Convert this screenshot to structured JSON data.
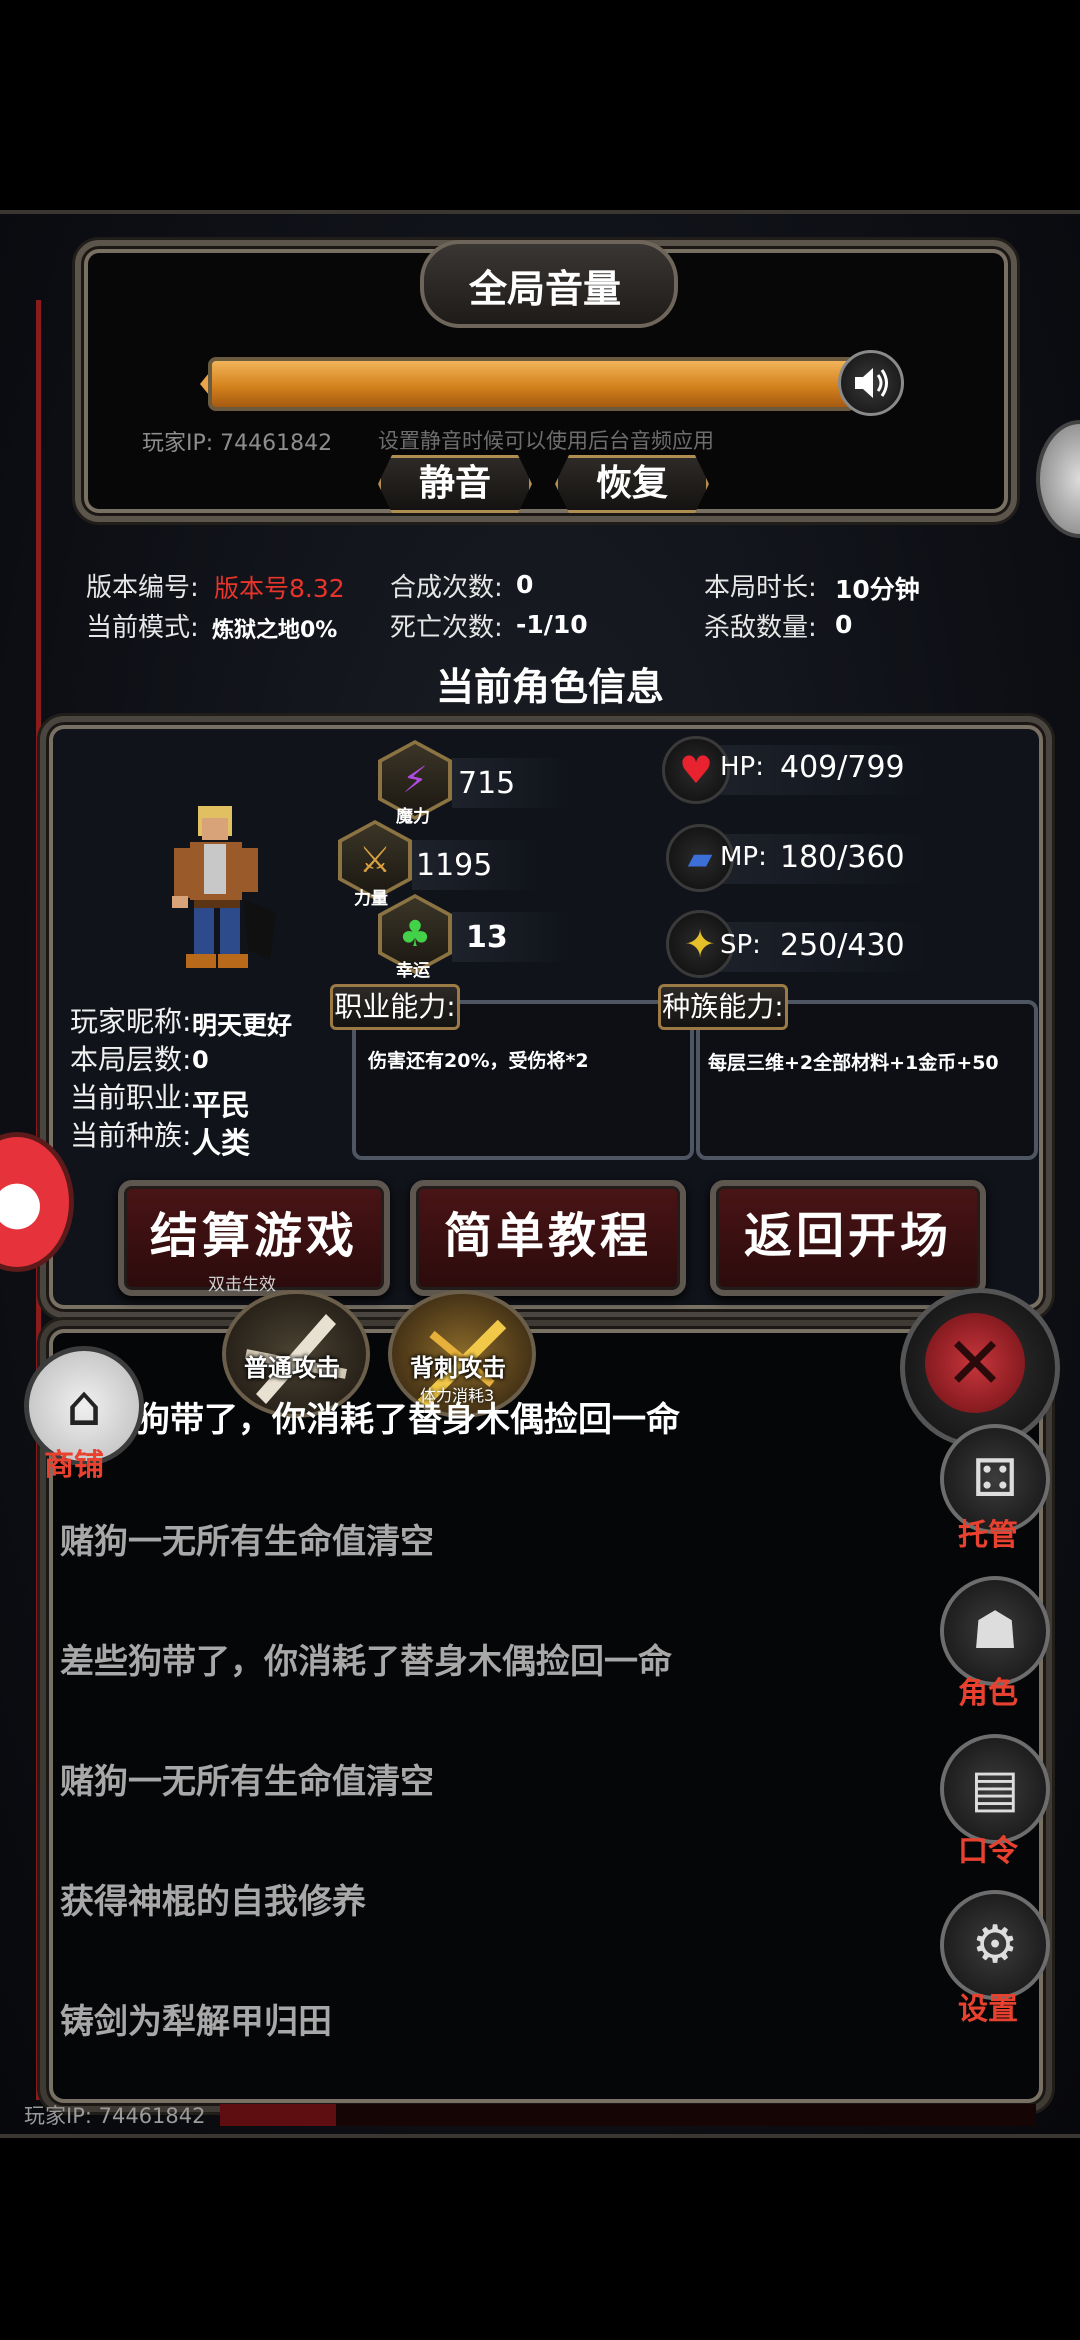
{
  "volume": {
    "title": "全局音量",
    "level": 1.0,
    "player_ip": "玩家IP: 74461842",
    "hint": "设置静音时候可以使用后台音频应用",
    "mute_label": "静音",
    "restore_label": "恢复"
  },
  "stats": {
    "version_label": "版本编号:",
    "version_value": "版本号8.32",
    "merge_label": "合成次数:",
    "merge_value": "0",
    "duration_label": "本局时长:",
    "duration_value": "10分钟",
    "mode_label": "当前模式:",
    "mode_value": "炼狱之地0%",
    "death_label": "死亡次数:",
    "death_value": "-1/10",
    "kills_label": "杀敌数量:",
    "kills_value": "0"
  },
  "character": {
    "section_title": "当前角色信息",
    "magic": {
      "value": "715",
      "caption": "魔力"
    },
    "strength": {
      "value": "1195",
      "caption": "力量"
    },
    "luck": {
      "value": "13",
      "caption": "幸运"
    },
    "hp": {
      "label": "HP:",
      "value": "409/799"
    },
    "mp": {
      "label": "MP:",
      "value": "180/360"
    },
    "sp": {
      "label": "SP:",
      "value": "250/430"
    },
    "nickname_label": "玩家昵称:",
    "nickname_value": "明天更好",
    "floors_label": "本局层数:",
    "floors_value": "0",
    "job_label": "当前职业:",
    "job_value": "平民",
    "race_label": "当前种族:",
    "race_value": "人类",
    "job_ability_tag": "职业能力:",
    "job_ability_text": "伤害还有20%，受伤将*2",
    "race_ability_tag": "种族能力:",
    "race_ability_text": "每层三维+2全部材料+1金币+50"
  },
  "actions": {
    "settle": "结算游戏",
    "settle_sub": "双击生效",
    "tutorial": "简单教程",
    "back": "返回开场"
  },
  "skills": {
    "normal": "普通攻击",
    "backstab": "背刺攻击",
    "backstab_sub": "体力消耗3"
  },
  "log": [
    "狗带了，你消耗了替身木偶捡回一命",
    "赌狗一无所有生命值清空",
    "差些狗带了，你消耗了替身木偶捡回一命",
    "赌狗一无所有生命值清空",
    "获得神棍的自我修养",
    "铸剑为犁解甲归田"
  ],
  "side": {
    "shop": "商铺",
    "auto": "托管",
    "role": "角色",
    "code": "口令",
    "settings": "设置"
  },
  "footer": {
    "player_ip": "玩家IP: 74461842"
  }
}
